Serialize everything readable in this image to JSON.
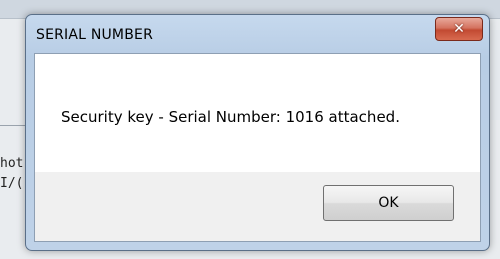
{
  "background_app": {
    "lines": [
      "hot",
      "I/("
    ]
  },
  "dialog": {
    "title": "SERIAL NUMBER",
    "close_icon": "close-icon",
    "message": "Security key - Serial Number: 1016 attached.",
    "ok_label": "OK"
  },
  "colors": {
    "close_button": "#c24a32",
    "frame": "#bfd2e8"
  }
}
